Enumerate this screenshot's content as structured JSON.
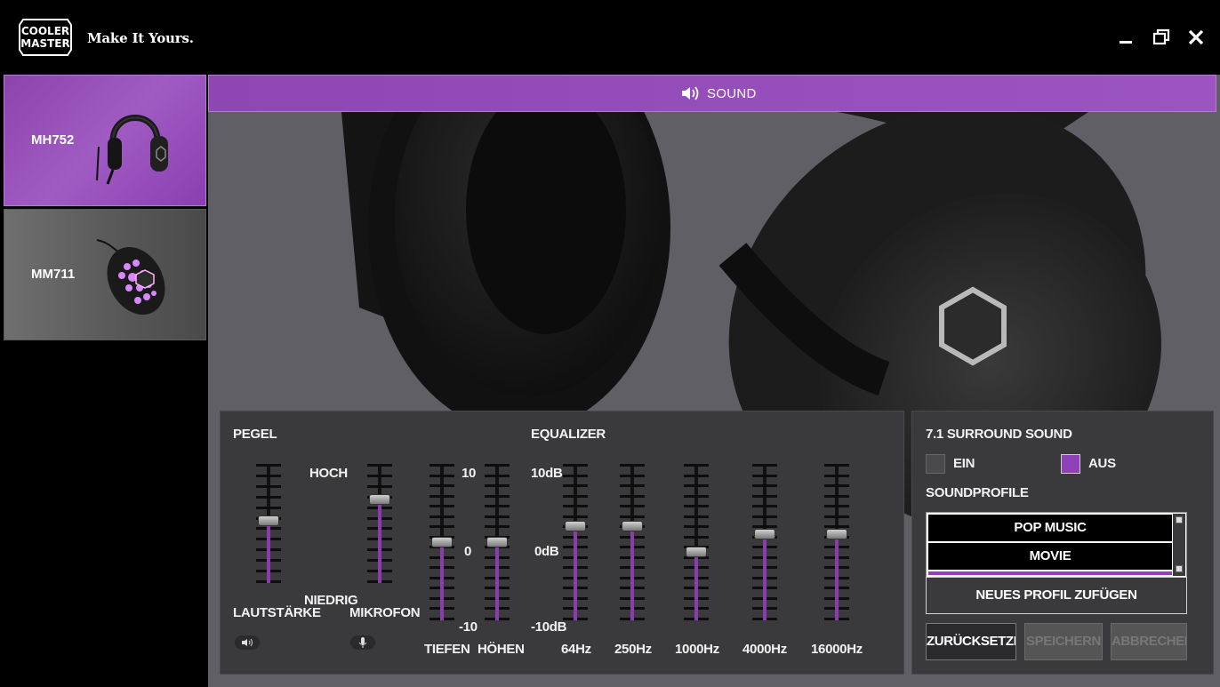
{
  "titlebar": {
    "logo_text": [
      "COOLER",
      "MASTER"
    ],
    "tagline": "Make It Yours."
  },
  "sidebar": {
    "devices": [
      {
        "name": "MH752",
        "selected": true
      },
      {
        "name": "MM711",
        "selected": false
      }
    ]
  },
  "section": {
    "title": "SOUND",
    "icon": "speaker-icon"
  },
  "pegel": {
    "title": "PEGEL",
    "hoch": "HOCH",
    "niedrig": "NIEDRIG",
    "volume_label": "LAUTSTÄRKE",
    "mic_label": "MIKROFON",
    "volume_level": 0.52,
    "mic_level": 0.7
  },
  "tone": {
    "top": "10",
    "mid": "0",
    "bottom": "-10",
    "bass_label": "TIEFEN",
    "treble_label": "HÖHEN",
    "bass_level": 0.5,
    "treble_level": 0.5
  },
  "equalizer": {
    "title": "EQUALIZER",
    "top": "10dB",
    "mid": "0dB",
    "bottom": "-10dB",
    "bands": [
      {
        "label": "64Hz",
        "level": 0.6
      },
      {
        "label": "250Hz",
        "level": 0.6
      },
      {
        "label": "1000Hz",
        "level": 0.44
      },
      {
        "label": "4000Hz",
        "level": 0.55
      },
      {
        "label": "16000Hz",
        "level": 0.55
      }
    ]
  },
  "surround": {
    "title": "7.1 SURROUND SOUND",
    "on_label": "EIN",
    "off_label": "AUS",
    "selected": "off"
  },
  "profiles": {
    "title": "SOUNDPROFILE",
    "items": [
      "POP MUSIC",
      "MOVIE"
    ],
    "add_label": "NEUES PROFIL ZUFÜGEN"
  },
  "buttons": {
    "reset": "ZURÜCKSETZEN",
    "save": "SPEICHERN",
    "cancel": "ABBRECHEN"
  },
  "colors": {
    "accent": "#9b4fc0",
    "panel": "#3a3a3c"
  }
}
